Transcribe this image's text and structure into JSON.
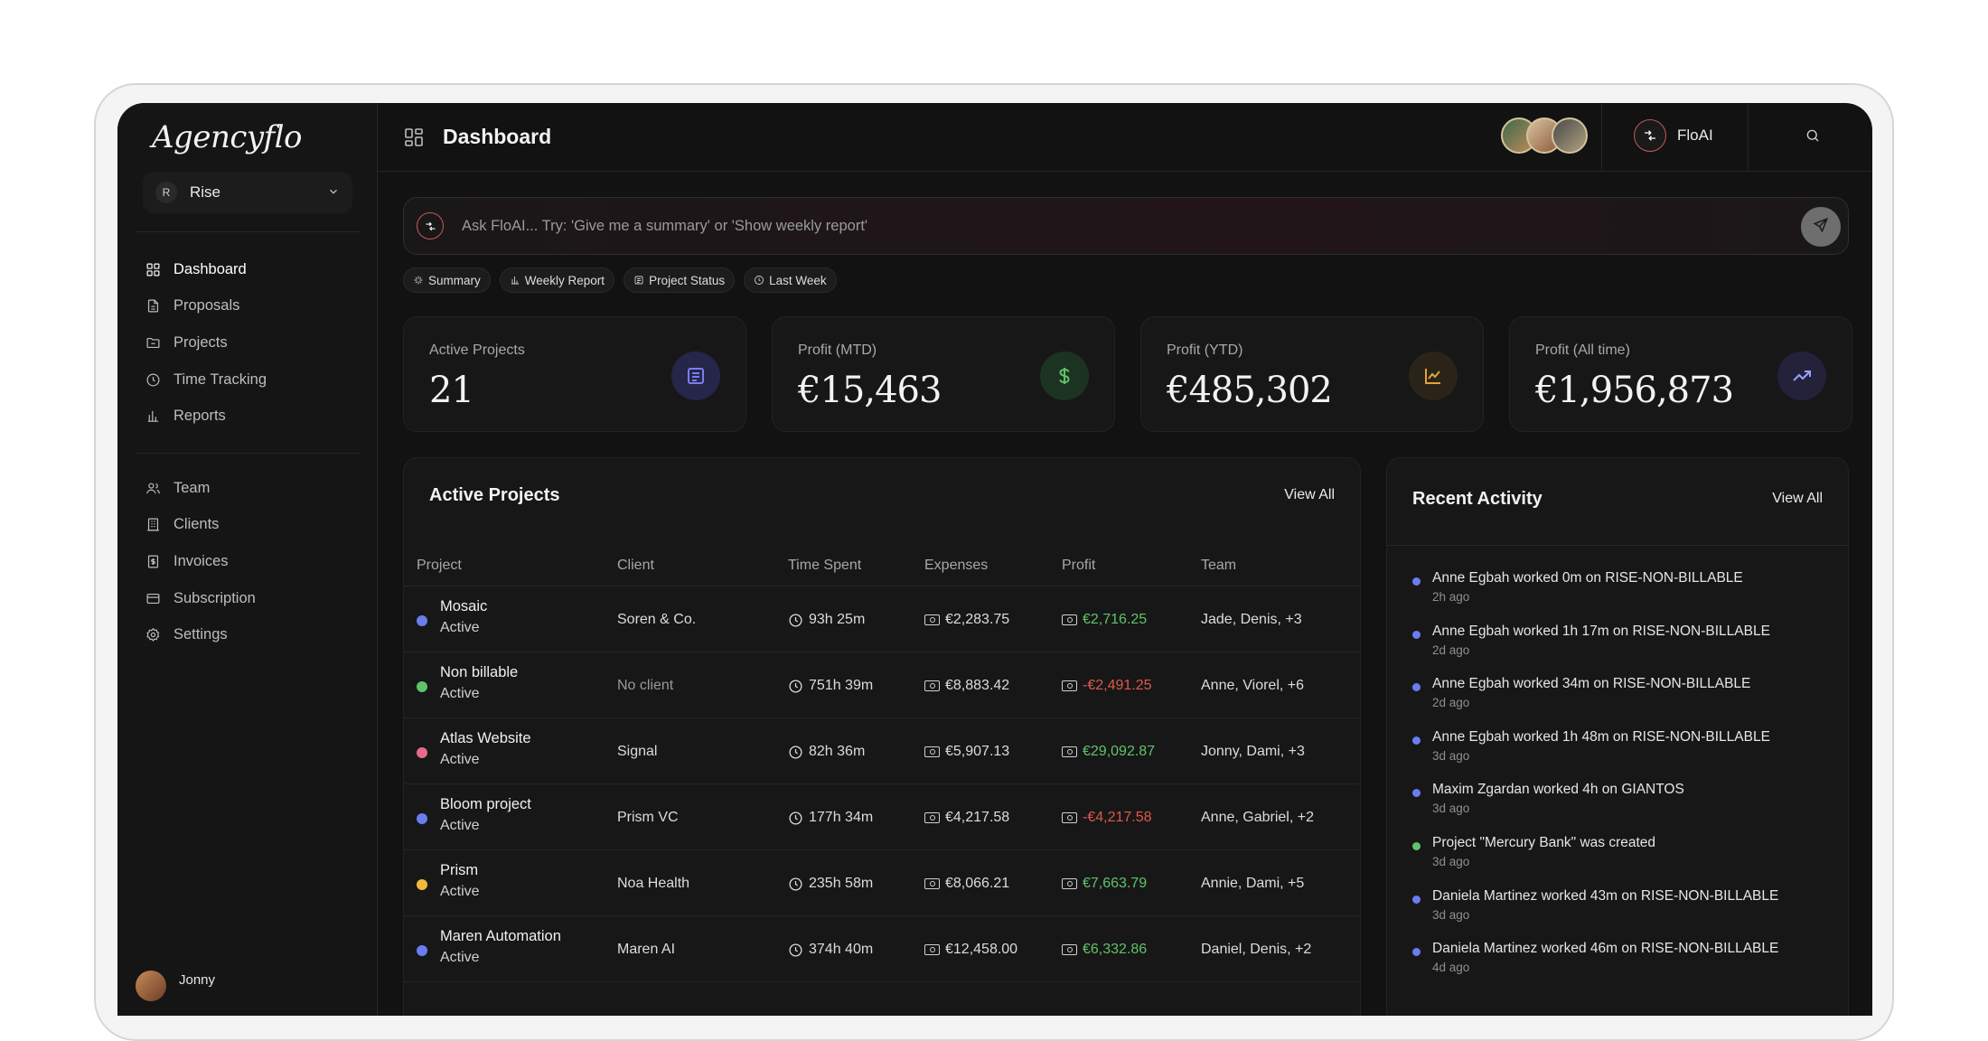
{
  "app": {
    "logo": "Agencyflo",
    "page_title": "Dashboard"
  },
  "workspace": {
    "badge": "R",
    "name": "Rise"
  },
  "sidebar": {
    "primary": [
      {
        "label": "Dashboard",
        "icon": "grid-icon",
        "active": true
      },
      {
        "label": "Proposals",
        "icon": "document-icon"
      },
      {
        "label": "Projects",
        "icon": "folder-icon"
      },
      {
        "label": "Time Tracking",
        "icon": "clock-icon"
      },
      {
        "label": "Reports",
        "icon": "bar-chart-icon"
      }
    ],
    "secondary": [
      {
        "label": "Team",
        "icon": "users-icon"
      },
      {
        "label": "Clients",
        "icon": "building-icon"
      },
      {
        "label": "Invoices",
        "icon": "receipt-icon"
      },
      {
        "label": "Subscription",
        "icon": "credit-card-icon"
      },
      {
        "label": "Settings",
        "icon": "gear-icon"
      }
    ],
    "user_name": "Jonny"
  },
  "topbar": {
    "floai_label": "FloAI"
  },
  "ask": {
    "placeholder": "Ask FloAI... Try: 'Give me a summary' or 'Show weekly report'"
  },
  "chips": [
    {
      "label": "Summary",
      "icon": "sparkle-icon"
    },
    {
      "label": "Weekly Report",
      "icon": "bar-chart-icon"
    },
    {
      "label": "Project Status",
      "icon": "list-icon"
    },
    {
      "label": "Last Week",
      "icon": "clock-icon"
    }
  ],
  "stats": [
    {
      "label": "Active Projects",
      "value": "21",
      "icon": "list-icon",
      "icon_color": "#7a7df0",
      "icon_bg": "#25264a"
    },
    {
      "label": "Profit (MTD)",
      "value": "€15,463",
      "icon": "dollar-icon",
      "icon_color": "#5fc36a",
      "icon_bg": "#1d3322"
    },
    {
      "label": "Profit (YTD)",
      "value": "€485,302",
      "icon": "line-chart-icon",
      "icon_color": "#e3a33a",
      "icon_bg": "#2a2418"
    },
    {
      "label": "Profit (All time)",
      "value": "€1,956,873",
      "icon": "trending-up-icon",
      "icon_color": "#9aa0ff",
      "icon_bg": "#23223a"
    }
  ],
  "active_projects": {
    "title": "Active Projects",
    "view_all": "View All",
    "columns": [
      "Project",
      "Client",
      "Time Spent",
      "Expenses",
      "Profit",
      "Team"
    ],
    "rows": [
      {
        "name": "Mosaic",
        "status": "Active",
        "color": "#6a7df0",
        "client": "Soren & Co.",
        "client_muted": false,
        "time": "93h 25m",
        "expenses": "€2,283.75",
        "profit": "€2,716.25",
        "profit_positive": true,
        "team": "Jade, Denis, +3"
      },
      {
        "name": "Non billable",
        "status": "Active",
        "color": "#5fc36a",
        "client": "No client",
        "client_muted": true,
        "time": "751h 39m",
        "expenses": "€8,883.42",
        "profit": "-€2,491.25",
        "profit_positive": false,
        "team": "Anne, Viorel, +6"
      },
      {
        "name": "Atlas Website",
        "status": "Active",
        "color": "#e46a8a",
        "client": "Signal",
        "client_muted": false,
        "time": "82h 36m",
        "expenses": "€5,907.13",
        "profit": "€29,092.87",
        "profit_positive": true,
        "team": "Jonny, Dami, +3"
      },
      {
        "name": "Bloom project",
        "status": "Active",
        "color": "#6a7df0",
        "client": "Prism VC",
        "client_muted": false,
        "time": "177h 34m",
        "expenses": "€4,217.58",
        "profit": "-€4,217.58",
        "profit_positive": false,
        "team": "Anne, Gabriel, +2"
      },
      {
        "name": "Prism",
        "status": "Active",
        "color": "#f0b93a",
        "client": "Noa Health",
        "client_muted": false,
        "time": "235h 58m",
        "expenses": "€8,066.21",
        "profit": "€7,663.79",
        "profit_positive": true,
        "team": "Annie, Dami, +5"
      },
      {
        "name": "Maren Automation",
        "status": "Active",
        "color": "#6a7df0",
        "client": "Maren AI",
        "client_muted": false,
        "time": "374h 40m",
        "expenses": "€12,458.00",
        "profit": "€6,332.86",
        "profit_positive": true,
        "team": "Daniel, Denis, +2"
      }
    ]
  },
  "recent_activity": {
    "title": "Recent Activity",
    "view_all": "View All",
    "items": [
      {
        "text": "Anne Egbah worked 0m on RISE-NON-BILLABLE",
        "time": "2h ago",
        "color": "#6a7df0"
      },
      {
        "text": "Anne Egbah worked 1h 17m on RISE-NON-BILLABLE",
        "time": "2d ago",
        "color": "#6a7df0"
      },
      {
        "text": "Anne Egbah worked 34m on RISE-NON-BILLABLE",
        "time": "2d ago",
        "color": "#6a7df0"
      },
      {
        "text": "Anne Egbah worked 1h 48m on RISE-NON-BILLABLE",
        "time": "3d ago",
        "color": "#6a7df0"
      },
      {
        "text": "Maxim Zgardan worked 4h on GIANTOS",
        "time": "3d ago",
        "color": "#6a7df0"
      },
      {
        "text": "Project \"Mercury Bank\" was created",
        "time": "3d ago",
        "color": "#5fc36a"
      },
      {
        "text": "Daniela Martinez worked 43m on RISE-NON-BILLABLE",
        "time": "3d ago",
        "color": "#6a7df0"
      },
      {
        "text": "Daniela Martinez worked 46m on RISE-NON-BILLABLE",
        "time": "4d ago",
        "color": "#6a7df0"
      }
    ]
  }
}
